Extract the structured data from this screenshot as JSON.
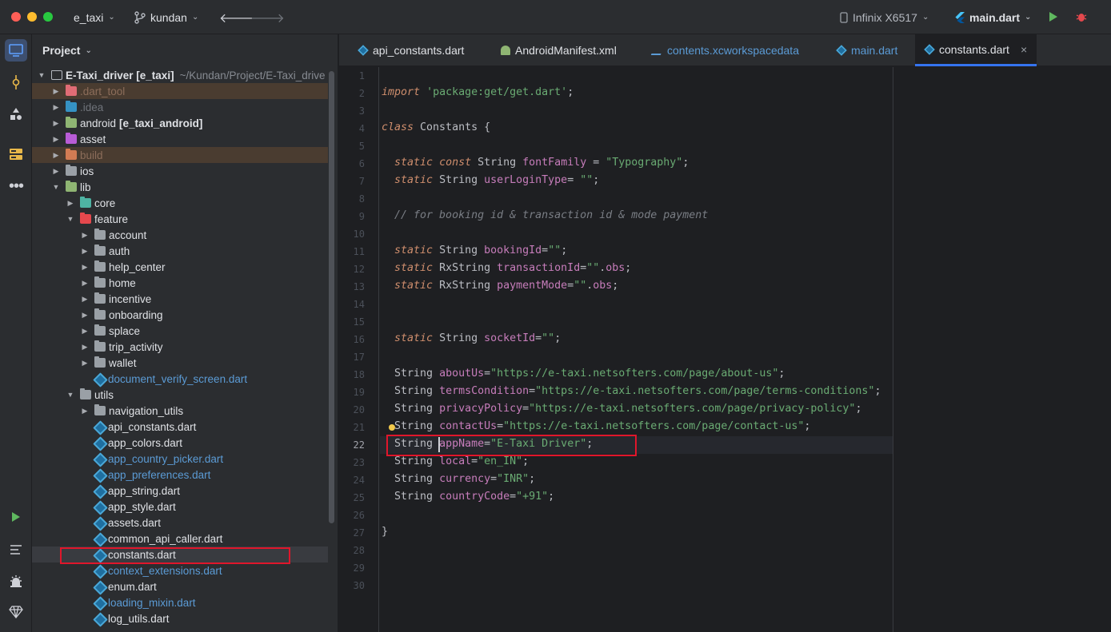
{
  "titlebar": {
    "project_name": "e_taxi",
    "branch": "kundan",
    "device": "Infinix X6517",
    "run_config": "main.dart"
  },
  "project_panel": {
    "title": "Project",
    "root_label": "E-Taxi_driver [e_taxi]",
    "root_path": "~/Kundan/Project/E-Taxi_drive",
    "items": [
      {
        "label": ".dart_tool",
        "depth": 1,
        "expanded": false,
        "kind": "folder",
        "color": "#e06c75",
        "excluded": true
      },
      {
        "label": ".idea",
        "depth": 1,
        "expanded": false,
        "kind": "folder",
        "color": "#3592c4",
        "dim": true
      },
      {
        "label": "android",
        "suffix": "[e_taxi_android]",
        "depth": 1,
        "expanded": false,
        "kind": "folder",
        "color": "#8fb573"
      },
      {
        "label": "asset",
        "depth": 1,
        "expanded": false,
        "kind": "folder",
        "color": "#b85cd6"
      },
      {
        "label": "build",
        "depth": 1,
        "expanded": false,
        "kind": "folder",
        "color": "#d27b53",
        "excluded": true
      },
      {
        "label": "ios",
        "depth": 1,
        "expanded": false,
        "kind": "folder",
        "color": "#9aa0a6"
      },
      {
        "label": "lib",
        "depth": 1,
        "expanded": true,
        "kind": "folder",
        "color": "#8fb573"
      },
      {
        "label": "core",
        "depth": 2,
        "expanded": false,
        "kind": "folder",
        "color": "#4eb3a3"
      },
      {
        "label": "feature",
        "depth": 2,
        "expanded": true,
        "kind": "folder",
        "color": "#e5484d"
      },
      {
        "label": "account",
        "depth": 3,
        "expanded": false,
        "kind": "folder",
        "color": "#9aa0a6"
      },
      {
        "label": "auth",
        "depth": 3,
        "expanded": false,
        "kind": "folder",
        "color": "#9aa0a6"
      },
      {
        "label": "help_center",
        "depth": 3,
        "expanded": false,
        "kind": "folder",
        "color": "#9aa0a6"
      },
      {
        "label": "home",
        "depth": 3,
        "expanded": false,
        "kind": "folder",
        "color": "#9aa0a6"
      },
      {
        "label": "incentive",
        "depth": 3,
        "expanded": false,
        "kind": "folder",
        "color": "#9aa0a6"
      },
      {
        "label": "onboarding",
        "depth": 3,
        "expanded": false,
        "kind": "folder",
        "color": "#9aa0a6"
      },
      {
        "label": "splace",
        "depth": 3,
        "expanded": false,
        "kind": "folder",
        "color": "#9aa0a6"
      },
      {
        "label": "trip_activity",
        "depth": 3,
        "expanded": false,
        "kind": "folder",
        "color": "#9aa0a6"
      },
      {
        "label": "wallet",
        "depth": 3,
        "expanded": false,
        "kind": "folder",
        "color": "#9aa0a6"
      },
      {
        "label": "document_verify_screen.dart",
        "depth": 3,
        "kind": "dart",
        "modified": true
      },
      {
        "label": "utils",
        "depth": 2,
        "expanded": true,
        "kind": "folder",
        "color": "#9aa0a6"
      },
      {
        "label": "navigation_utils",
        "depth": 3,
        "expanded": false,
        "kind": "folder",
        "color": "#9aa0a6"
      },
      {
        "label": "api_constants.dart",
        "depth": 3,
        "kind": "dart"
      },
      {
        "label": "app_colors.dart",
        "depth": 3,
        "kind": "dart"
      },
      {
        "label": "app_country_picker.dart",
        "depth": 3,
        "kind": "dart",
        "modified": true
      },
      {
        "label": "app_preferences.dart",
        "depth": 3,
        "kind": "dart",
        "modified": true
      },
      {
        "label": "app_string.dart",
        "depth": 3,
        "kind": "dart"
      },
      {
        "label": "app_style.dart",
        "depth": 3,
        "kind": "dart"
      },
      {
        "label": "assets.dart",
        "depth": 3,
        "kind": "dart"
      },
      {
        "label": "common_api_caller.dart",
        "depth": 3,
        "kind": "dart"
      },
      {
        "label": "constants.dart",
        "depth": 3,
        "kind": "dart",
        "selected": true
      },
      {
        "label": "context_extensions.dart",
        "depth": 3,
        "kind": "dart",
        "modified": true
      },
      {
        "label": "enum.dart",
        "depth": 3,
        "kind": "dart"
      },
      {
        "label": "loading_mixin.dart",
        "depth": 3,
        "kind": "dart",
        "modified": true
      },
      {
        "label": "log_utils.dart",
        "depth": 3,
        "kind": "dart"
      }
    ]
  },
  "tabs": [
    {
      "label": "api_constants.dart",
      "icon": "dart-icon",
      "active": false
    },
    {
      "label": "AndroidManifest.xml",
      "icon": "android-icon",
      "active": false
    },
    {
      "label": "contents.xcworkspacedata",
      "icon": "xcode-icon",
      "active": false,
      "modified": true
    },
    {
      "label": "main.dart",
      "icon": "dart-icon",
      "active": false,
      "modified": true
    },
    {
      "label": "constants.dart",
      "icon": "dart-icon",
      "active": true
    }
  ],
  "editor": {
    "current_line": 22,
    "lines": [
      {
        "n": "1",
        "tokens": []
      },
      {
        "n": "2",
        "tokens": [
          [
            "k",
            "import"
          ],
          [
            "t",
            " "
          ],
          [
            "s",
            "'package:get/get.dart'"
          ],
          [
            "t",
            ";"
          ]
        ]
      },
      {
        "n": "3",
        "tokens": []
      },
      {
        "n": "4",
        "tokens": [
          [
            "k",
            "class"
          ],
          [
            "t",
            " Constants {"
          ]
        ]
      },
      {
        "n": "5",
        "tokens": []
      },
      {
        "n": "6",
        "tokens": [
          [
            "t",
            "  "
          ],
          [
            "k",
            "static"
          ],
          [
            "t",
            " "
          ],
          [
            "k",
            "const"
          ],
          [
            "t",
            " String "
          ],
          [
            "v",
            "fontFamily"
          ],
          [
            "t",
            " = "
          ],
          [
            "s",
            "\"Typography\""
          ],
          [
            "t",
            ";"
          ]
        ]
      },
      {
        "n": "7",
        "tokens": [
          [
            "t",
            "  "
          ],
          [
            "k",
            "static"
          ],
          [
            "t",
            " String "
          ],
          [
            "v",
            "userLoginType"
          ],
          [
            "t",
            "= "
          ],
          [
            "s",
            "\"\""
          ],
          [
            "t",
            ";"
          ]
        ]
      },
      {
        "n": "8",
        "tokens": []
      },
      {
        "n": "9",
        "tokens": [
          [
            "t",
            "  "
          ],
          [
            "c",
            "// for booking id & transaction id & mode payment"
          ]
        ]
      },
      {
        "n": "10",
        "tokens": []
      },
      {
        "n": "11",
        "tokens": [
          [
            "t",
            "  "
          ],
          [
            "k",
            "static"
          ],
          [
            "t",
            " String "
          ],
          [
            "v",
            "bookingId"
          ],
          [
            "t",
            "="
          ],
          [
            "s",
            "\"\""
          ],
          [
            "t",
            ";"
          ]
        ]
      },
      {
        "n": "12",
        "tokens": [
          [
            "t",
            "  "
          ],
          [
            "k",
            "static"
          ],
          [
            "t",
            " RxString "
          ],
          [
            "v",
            "transactionId"
          ],
          [
            "t",
            "="
          ],
          [
            "s",
            "\"\""
          ],
          [
            "t",
            "."
          ],
          [
            "m",
            "obs"
          ],
          [
            "t",
            ";"
          ]
        ]
      },
      {
        "n": "13",
        "tokens": [
          [
            "t",
            "  "
          ],
          [
            "k",
            "static"
          ],
          [
            "t",
            " RxString "
          ],
          [
            "v",
            "paymentMode"
          ],
          [
            "t",
            "="
          ],
          [
            "s",
            "\"\""
          ],
          [
            "t",
            "."
          ],
          [
            "m",
            "obs"
          ],
          [
            "t",
            ";"
          ]
        ]
      },
      {
        "n": "14",
        "tokens": []
      },
      {
        "n": "15",
        "tokens": []
      },
      {
        "n": "16",
        "tokens": [
          [
            "t",
            "  "
          ],
          [
            "k",
            "static"
          ],
          [
            "t",
            " String "
          ],
          [
            "v",
            "socketId"
          ],
          [
            "t",
            "="
          ],
          [
            "s",
            "\"\""
          ],
          [
            "t",
            ";"
          ]
        ]
      },
      {
        "n": "17",
        "tokens": []
      },
      {
        "n": "18",
        "tokens": [
          [
            "t",
            "  String "
          ],
          [
            "v",
            "aboutUs"
          ],
          [
            "t",
            "="
          ],
          [
            "s",
            "\"https://e-taxi.netsofters.com/page/about-us\""
          ],
          [
            "t",
            ";"
          ]
        ]
      },
      {
        "n": "19",
        "tokens": [
          [
            "t",
            "  String "
          ],
          [
            "v",
            "termsCondition"
          ],
          [
            "t",
            "="
          ],
          [
            "s",
            "\"https://e-taxi.netsofters.com/page/terms-conditions\""
          ],
          [
            "t",
            ";"
          ]
        ]
      },
      {
        "n": "20",
        "tokens": [
          [
            "t",
            "  String "
          ],
          [
            "v",
            "privacyPolicy"
          ],
          [
            "t",
            "="
          ],
          [
            "s",
            "\"https://e-taxi.netsofters.com/page/privacy-policy\""
          ],
          [
            "t",
            ";"
          ]
        ]
      },
      {
        "n": "21",
        "tokens": [
          [
            "t",
            "  String "
          ],
          [
            "v",
            "contactUs"
          ],
          [
            "t",
            "="
          ],
          [
            "s",
            "\"https://e-taxi.netsofters.com/page/contact-us\""
          ],
          [
            "t",
            ";"
          ]
        ]
      },
      {
        "n": "22",
        "tokens": [
          [
            "t",
            "  String "
          ],
          [
            "v",
            "appName"
          ],
          [
            "t",
            "="
          ],
          [
            "s",
            "\"E-Taxi Driver\""
          ],
          [
            "t",
            ";"
          ]
        ]
      },
      {
        "n": "23",
        "tokens": [
          [
            "t",
            "  String "
          ],
          [
            "v",
            "local"
          ],
          [
            "t",
            "="
          ],
          [
            "s",
            "\"en_IN\""
          ],
          [
            "t",
            ";"
          ]
        ]
      },
      {
        "n": "24",
        "tokens": [
          [
            "t",
            "  String "
          ],
          [
            "v",
            "currency"
          ],
          [
            "t",
            "="
          ],
          [
            "s",
            "\"INR\""
          ],
          [
            "t",
            ";"
          ]
        ]
      },
      {
        "n": "25",
        "tokens": [
          [
            "t",
            "  String "
          ],
          [
            "v",
            "countryCode"
          ],
          [
            "t",
            "="
          ],
          [
            "s",
            "\"+91\""
          ],
          [
            "t",
            ";"
          ]
        ]
      },
      {
        "n": "26",
        "tokens": []
      },
      {
        "n": "27",
        "tokens": [
          [
            "t",
            "}"
          ]
        ]
      },
      {
        "n": "28",
        "tokens": []
      },
      {
        "n": "29",
        "tokens": []
      },
      {
        "n": "30",
        "tokens": []
      }
    ]
  },
  "colors": {
    "accent": "#3574f0",
    "highlight_box": "#e0162b",
    "modified_file": "#5b9bd5"
  }
}
